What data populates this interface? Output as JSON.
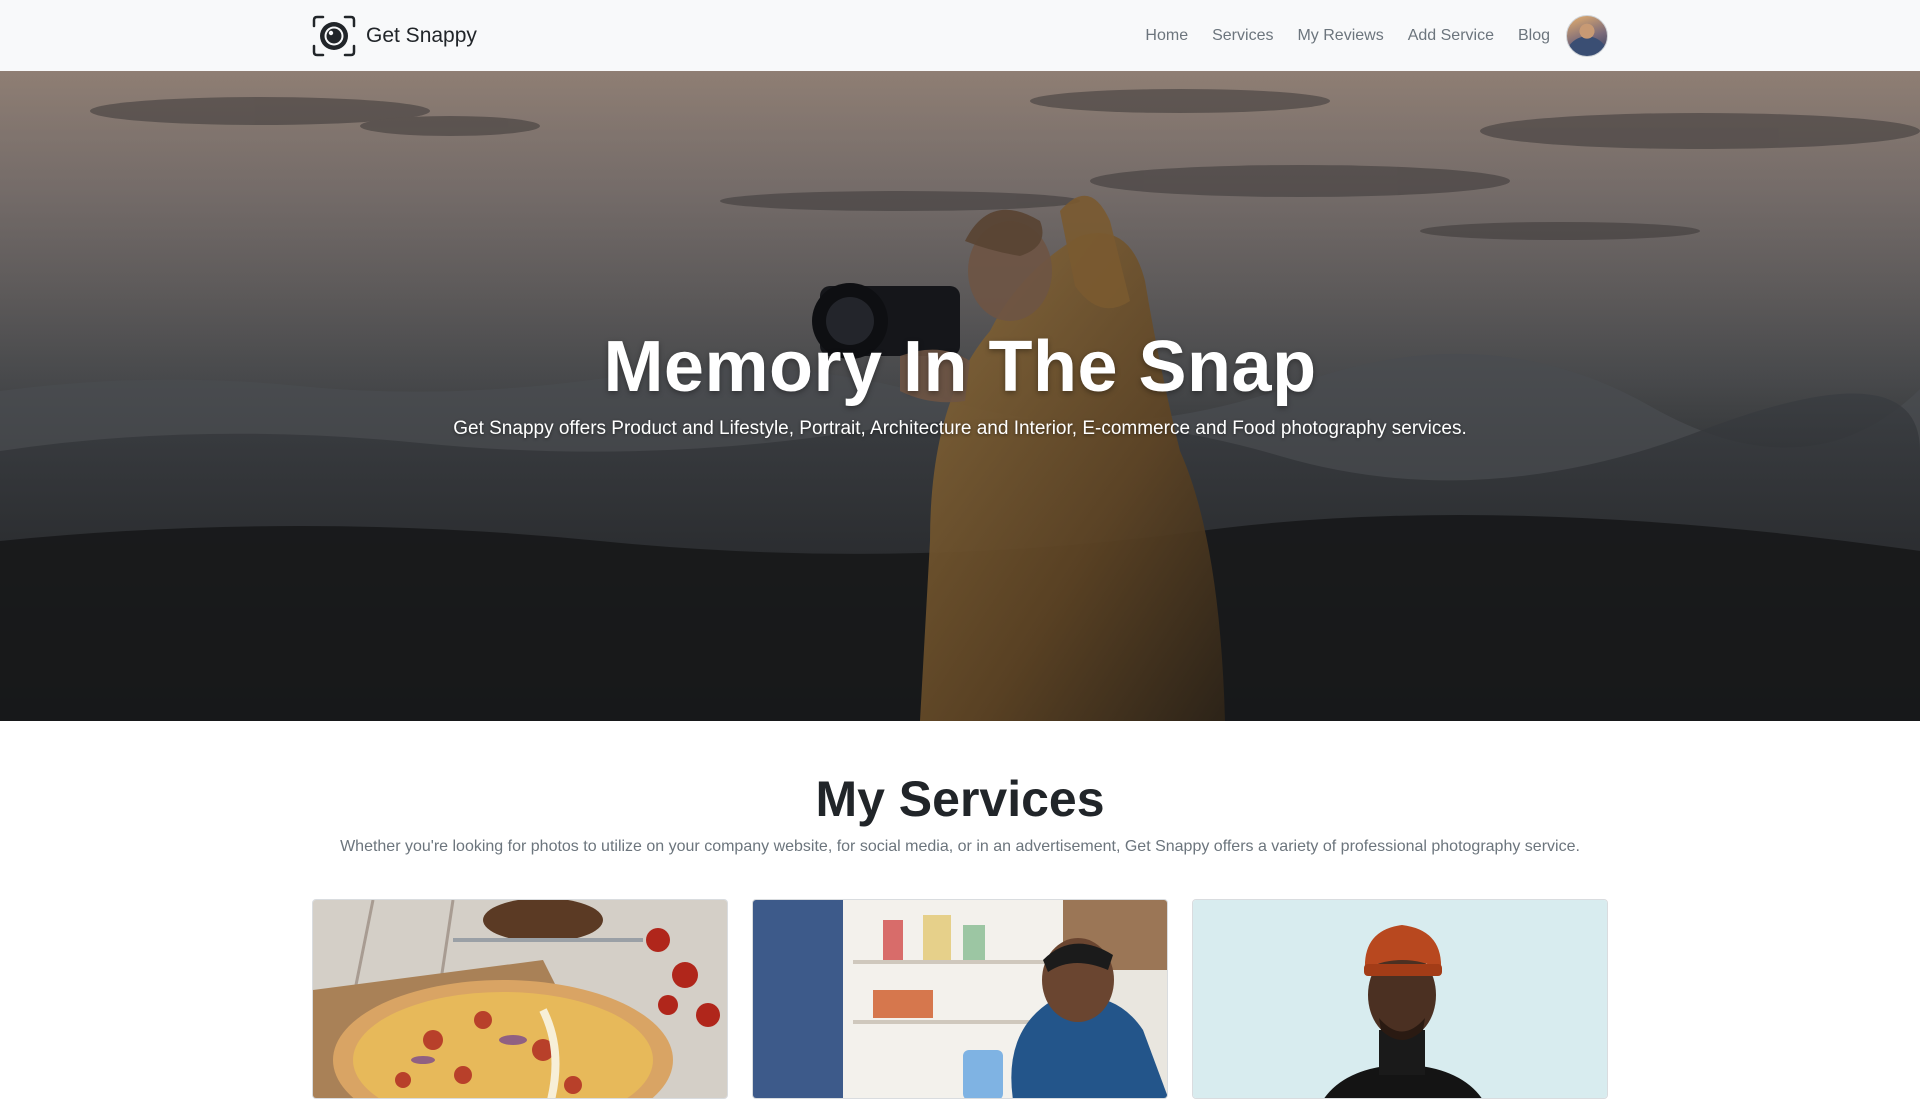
{
  "navbar": {
    "brand_name": "Get Snappy",
    "brand_icon": "camera-lens-icon",
    "links": [
      {
        "label": "Home"
      },
      {
        "label": "Services"
      },
      {
        "label": "My Reviews"
      },
      {
        "label": "Add Service"
      },
      {
        "label": "Blog"
      }
    ],
    "avatar": "user-avatar"
  },
  "hero": {
    "title": "Memory In The Snap",
    "subtitle": "Get Snappy offers Product and Lifestyle, Portrait, Architecture and Interior, E-commerce and Food photography services."
  },
  "services": {
    "title": "My Services",
    "description": "Whether you're looking for photos to utilize on your company website, for social media, or in an advertisement, Get Snappy offers a variety of professional photography service.",
    "cards": [
      {
        "image": "pizza-photo"
      },
      {
        "image": "refrigerator-photo"
      },
      {
        "image": "portrait-photo"
      }
    ]
  },
  "colors": {
    "navbar_bg": "#f8f9fa",
    "nav_link": "#6c757d",
    "heading": "#212529",
    "hero_text": "#ffffff"
  }
}
